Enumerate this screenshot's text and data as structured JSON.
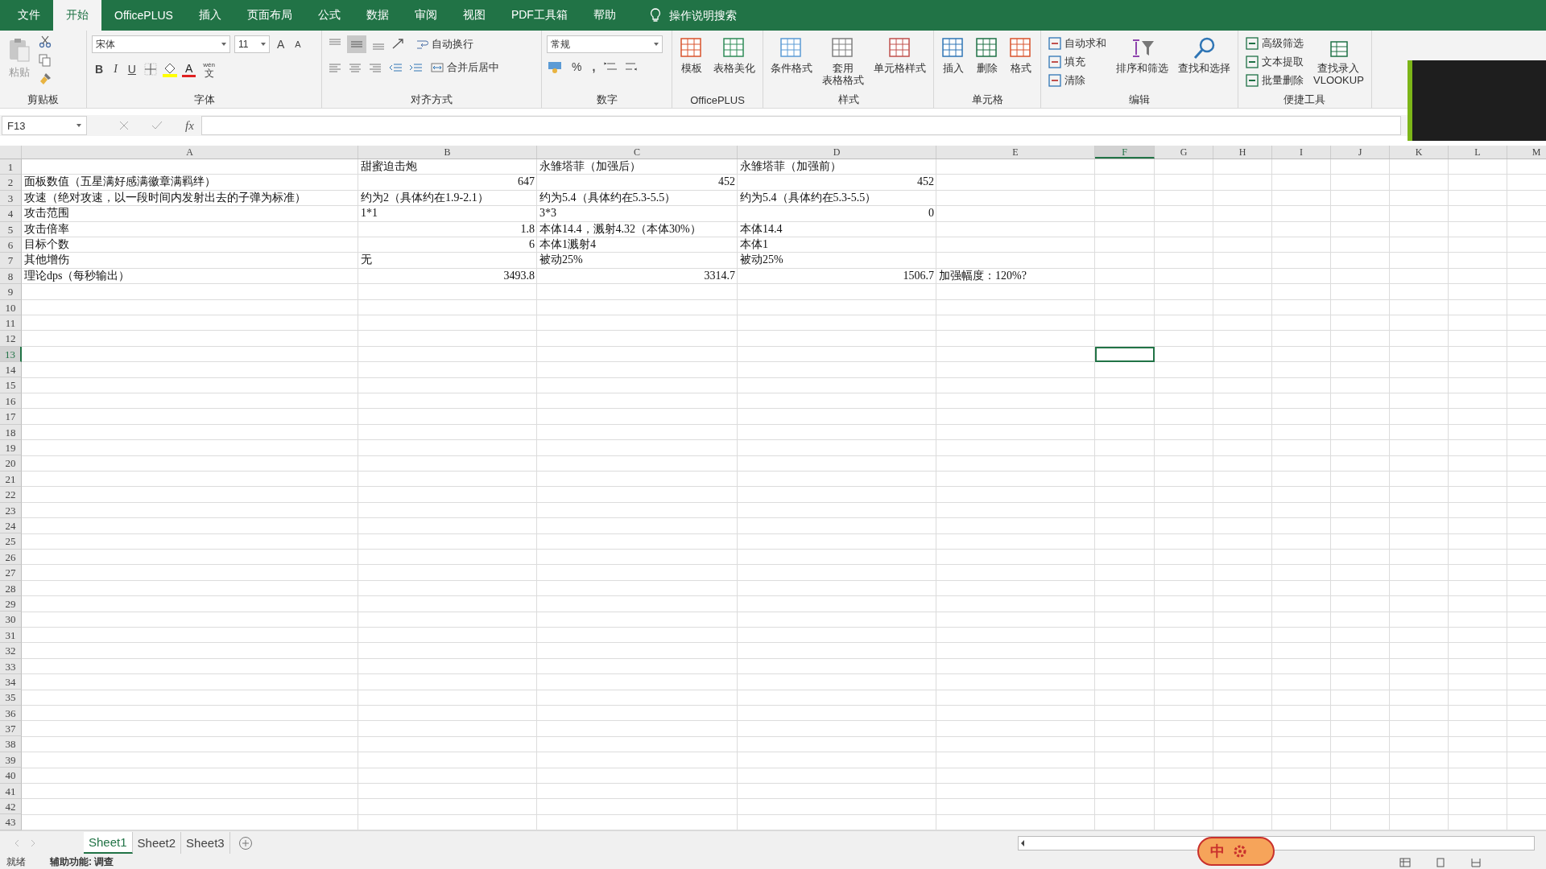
{
  "menu_tabs": [
    {
      "label": "文件",
      "selected": false
    },
    {
      "label": "开始",
      "selected": true
    },
    {
      "label": "OfficePLUS",
      "selected": false
    },
    {
      "label": "插入",
      "selected": false
    },
    {
      "label": "页面布局",
      "selected": false
    },
    {
      "label": "公式",
      "selected": false
    },
    {
      "label": "数据",
      "selected": false
    },
    {
      "label": "审阅",
      "selected": false
    },
    {
      "label": "视图",
      "selected": false
    },
    {
      "label": "PDF工具箱",
      "selected": false
    },
    {
      "label": "帮助",
      "selected": false
    }
  ],
  "tell_me": {
    "placeholder": "操作说明搜索"
  },
  "ribbon": {
    "clipboard": {
      "label": "剪贴板",
      "paste": "粘贴"
    },
    "font": {
      "label": "字体",
      "font_name": "宋体",
      "font_size": "11",
      "grow": "A",
      "shrink": "A",
      "bold": "B",
      "italic": "I",
      "underline": "U",
      "font_color": "A",
      "phonetic_top": "wén",
      "phonetic": "文"
    },
    "alignment": {
      "label": "对齐方式",
      "wrap": "自动换行",
      "merge": "合并后居中"
    },
    "number": {
      "label": "数字",
      "format": "常规",
      "percent": "%",
      "comma": ","
    },
    "officeplus": {
      "label": "OfficePLUS",
      "buttons": [
        {
          "lines": [
            "模板"
          ]
        },
        {
          "lines": [
            "表格美化"
          ]
        }
      ]
    },
    "styles": {
      "label": "样式",
      "buttons": [
        {
          "lines": [
            "条件格式"
          ]
        },
        {
          "lines": [
            "套用",
            "表格格式"
          ]
        },
        {
          "lines": [
            "单元格样式"
          ]
        }
      ]
    },
    "cells": {
      "label": "单元格",
      "buttons": [
        {
          "lines": [
            "插入"
          ]
        },
        {
          "lines": [
            "删除"
          ]
        },
        {
          "lines": [
            "格式"
          ]
        }
      ]
    },
    "editing": {
      "label": "编辑",
      "small": [
        {
          "label": "自动求和"
        },
        {
          "label": "填充"
        },
        {
          "label": "清除"
        }
      ],
      "buttons": [
        {
          "lines": [
            "排序和筛选"
          ]
        },
        {
          "lines": [
            "查找和选择"
          ]
        }
      ]
    },
    "tools": {
      "label": "便捷工具",
      "small": [
        {
          "label": "高级筛选"
        },
        {
          "label": "文本提取"
        },
        {
          "label": "批量删除"
        }
      ],
      "buttons": [
        {
          "lines": [
            "查找录入",
            "VLOOKUP"
          ]
        }
      ]
    }
  },
  "name_box": "F13",
  "fx": "fx",
  "columns": [
    {
      "label": "A",
      "selected": false
    },
    {
      "label": "B",
      "selected": false
    },
    {
      "label": "C",
      "selected": false
    },
    {
      "label": "D",
      "selected": false
    },
    {
      "label": "E",
      "selected": false
    },
    {
      "label": "F",
      "selected": true
    },
    {
      "label": "G",
      "selected": false
    },
    {
      "label": "H",
      "selected": false
    },
    {
      "label": "I",
      "selected": false
    },
    {
      "label": "J",
      "selected": false
    },
    {
      "label": "K",
      "selected": false
    },
    {
      "label": "L",
      "selected": false
    },
    {
      "label": "M",
      "selected": false
    }
  ],
  "rows": [
    {
      "n": "1",
      "selected": false,
      "cells": [
        null,
        {
          "text": "甜蜜迫击炮",
          "kind": "text"
        },
        {
          "text": "永雏塔菲（加强后）",
          "kind": "text"
        },
        {
          "text": "永雏塔菲（加强前）",
          "kind": "text"
        },
        null
      ]
    },
    {
      "n": "2",
      "selected": false,
      "cells": [
        {
          "text": "面板数值（五星满好感满徽章满羁绊）",
          "kind": "text"
        },
        {
          "text": "647",
          "kind": "number"
        },
        {
          "text": "452",
          "kind": "number"
        },
        {
          "text": "452",
          "kind": "number"
        },
        null
      ]
    },
    {
      "n": "3",
      "selected": false,
      "cells": [
        {
          "text": "攻速（绝对攻速，以一段时间内发射出去的子弹为标准）",
          "kind": "text"
        },
        {
          "text": "约为2（具体约在1.9-2.1）",
          "kind": "text"
        },
        {
          "text": "约为5.4（具体约在5.3-5.5）",
          "kind": "text"
        },
        {
          "text": "约为5.4（具体约在5.3-5.5）",
          "kind": "text"
        },
        null
      ]
    },
    {
      "n": "4",
      "selected": false,
      "cells": [
        {
          "text": "攻击范围",
          "kind": "text"
        },
        {
          "text": "1*1",
          "kind": "text"
        },
        {
          "text": "3*3",
          "kind": "text"
        },
        {
          "text": "0",
          "kind": "number"
        },
        null
      ]
    },
    {
      "n": "5",
      "selected": false,
      "cells": [
        {
          "text": "攻击倍率",
          "kind": "text"
        },
        {
          "text": "1.8",
          "kind": "number"
        },
        {
          "text": "本体14.4，溅射4.32（本体30%）",
          "kind": "text"
        },
        {
          "text": "本体14.4",
          "kind": "text"
        },
        null
      ]
    },
    {
      "n": "6",
      "selected": false,
      "cells": [
        {
          "text": "目标个数",
          "kind": "text"
        },
        {
          "text": "6",
          "kind": "number"
        },
        {
          "text": "本体1溅射4",
          "kind": "text"
        },
        {
          "text": "本体1",
          "kind": "text"
        },
        null
      ]
    },
    {
      "n": "7",
      "selected": false,
      "cells": [
        {
          "text": "其他增伤",
          "kind": "text"
        },
        {
          "text": "无",
          "kind": "text"
        },
        {
          "text": "被动25%",
          "kind": "text"
        },
        {
          "text": "被动25%",
          "kind": "text"
        },
        null
      ]
    },
    {
      "n": "8",
      "selected": false,
      "cells": [
        {
          "text": "理论dps（每秒输出）",
          "kind": "text"
        },
        {
          "text": "3493.8",
          "kind": "number"
        },
        {
          "text": "3314.7",
          "kind": "number"
        },
        {
          "text": "1506.7",
          "kind": "number"
        },
        {
          "text": "加强幅度：120%?",
          "kind": "text"
        }
      ]
    },
    {
      "n": "9",
      "selected": false
    },
    {
      "n": "10",
      "selected": false
    },
    {
      "n": "11",
      "selected": false
    },
    {
      "n": "12",
      "selected": false
    },
    {
      "n": "13",
      "selected": true
    },
    {
      "n": "14",
      "selected": false
    },
    {
      "n": "15",
      "selected": false
    },
    {
      "n": "16",
      "selected": false
    },
    {
      "n": "17",
      "selected": false
    },
    {
      "n": "18",
      "selected": false
    },
    {
      "n": "19",
      "selected": false
    },
    {
      "n": "20",
      "selected": false
    },
    {
      "n": "21",
      "selected": false
    },
    {
      "n": "22",
      "selected": false
    },
    {
      "n": "23",
      "selected": false
    },
    {
      "n": "24",
      "selected": false
    },
    {
      "n": "25",
      "selected": false
    },
    {
      "n": "26",
      "selected": false
    },
    {
      "n": "27",
      "selected": false
    },
    {
      "n": "28",
      "selected": false
    },
    {
      "n": "29",
      "selected": false
    },
    {
      "n": "30",
      "selected": false
    },
    {
      "n": "31",
      "selected": false
    },
    {
      "n": "32",
      "selected": false
    },
    {
      "n": "33",
      "selected": false
    },
    {
      "n": "34",
      "selected": false
    },
    {
      "n": "35",
      "selected": false
    },
    {
      "n": "36",
      "selected": false
    },
    {
      "n": "37",
      "selected": false
    },
    {
      "n": "38",
      "selected": false
    },
    {
      "n": "39",
      "selected": false
    },
    {
      "n": "40",
      "selected": false
    },
    {
      "n": "41",
      "selected": false
    },
    {
      "n": "42",
      "selected": false
    },
    {
      "n": "43",
      "selected": false
    }
  ],
  "sheets": [
    {
      "label": "Sheet1",
      "selected": true
    },
    {
      "label": "Sheet2",
      "selected": false
    },
    {
      "label": "Sheet3",
      "selected": false
    }
  ],
  "status_bar": {
    "ready": "就绪",
    "accessibility": "辅助功能: 调查"
  },
  "ime": {
    "label": "中"
  }
}
